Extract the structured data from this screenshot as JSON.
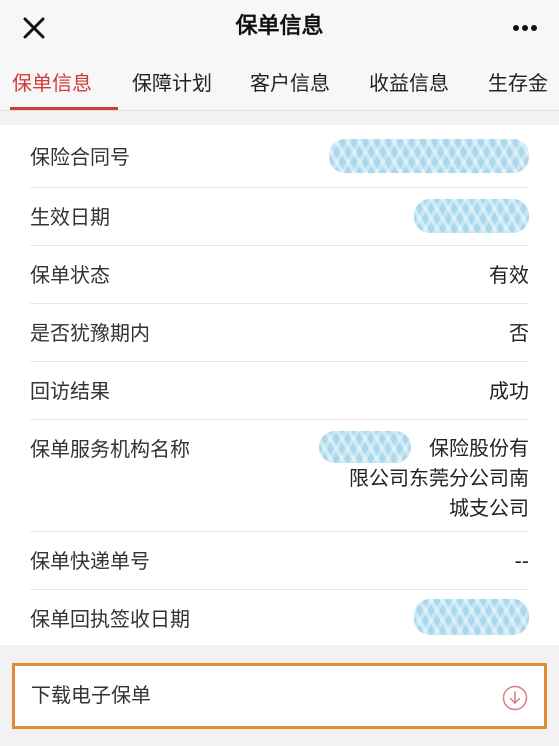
{
  "header": {
    "title": "保单信息",
    "close_icon": "close-icon",
    "more_icon": "more-icon"
  },
  "tabs": [
    {
      "label": "保单信息",
      "active": true
    },
    {
      "label": "保障计划",
      "active": false
    },
    {
      "label": "客户信息",
      "active": false
    },
    {
      "label": "收益信息",
      "active": false
    },
    {
      "label": "生存金",
      "active": false
    }
  ],
  "details": {
    "contract_no": {
      "label": "保险合同号"
    },
    "effective_date": {
      "label": "生效日期"
    },
    "status": {
      "label": "保单状态",
      "value": "有效"
    },
    "cooling_off": {
      "label": "是否犹豫期内",
      "value": "否"
    },
    "callback": {
      "label": "回访结果",
      "value": "成功"
    },
    "service_org": {
      "label": "保单服务机构名称",
      "value_line1": "保险股份有",
      "value_line2": "限公司东莞分公司南",
      "value_line3": "城支公司"
    },
    "express_no": {
      "label": "保单快递单号",
      "value": "--"
    },
    "receipt_date": {
      "label": "保单回执签收日期"
    }
  },
  "download": {
    "label": "下载电子保单",
    "icon": "download-circle-icon"
  },
  "colors": {
    "accent": "#d23b3b",
    "highlight_border": "#e08a3c",
    "redaction": "#a9d8ec"
  }
}
